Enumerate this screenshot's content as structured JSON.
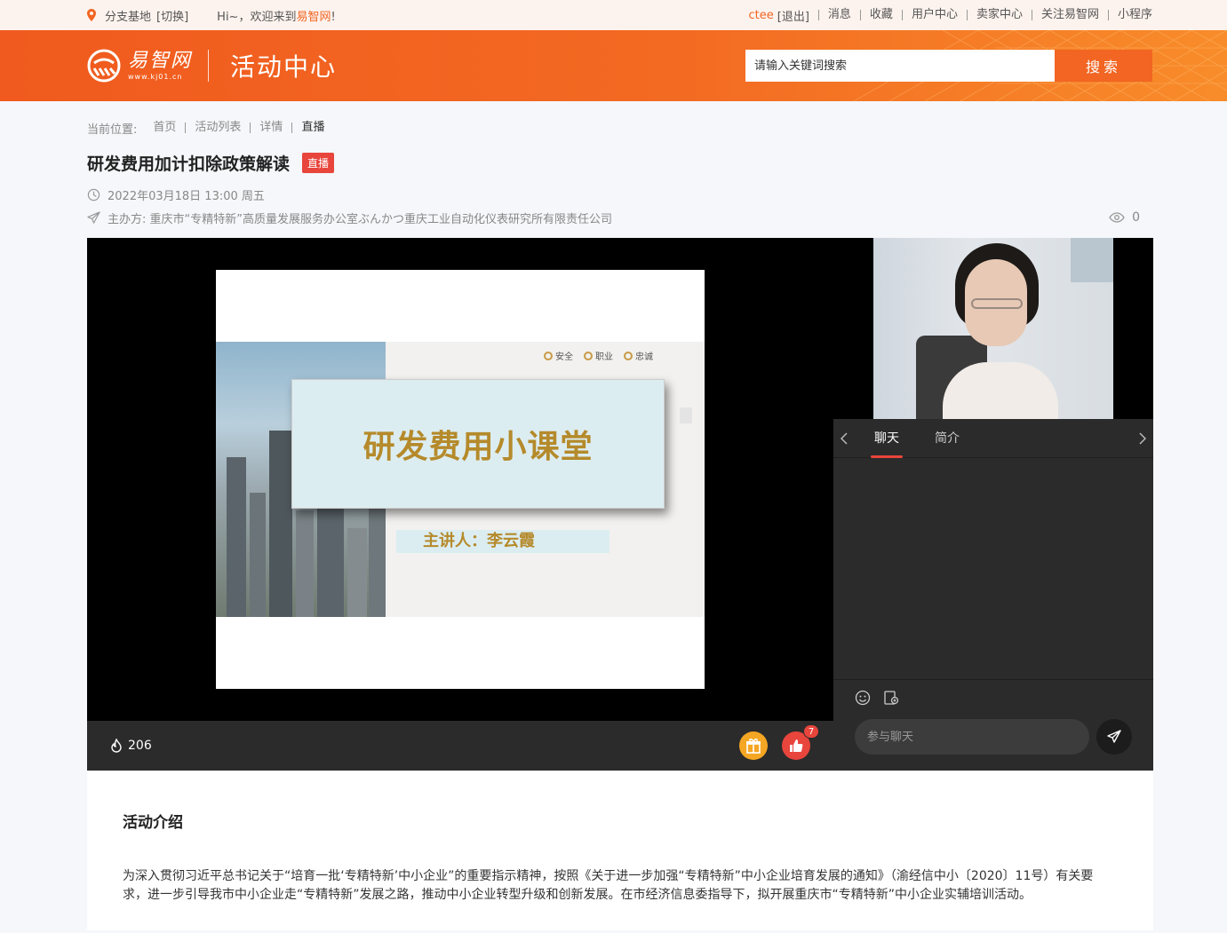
{
  "topbar": {
    "location": "分支基地",
    "switch": "[切换]",
    "greeting": "Hi~，欢迎来到",
    "brand": "易智网",
    "greeting_end": "!",
    "user": "ctee",
    "logout": "[退出]",
    "links": [
      "消息",
      "收藏",
      "用户中心",
      "卖家中心",
      "关注易智网",
      "小程序"
    ]
  },
  "header": {
    "logo_cn": "易智网",
    "logo_en": "www.kj01.cn",
    "section_title": "活动中心",
    "search_placeholder": "请输入关键词搜索",
    "search_button": "搜索"
  },
  "breadcrumb": {
    "label": "当前位置:",
    "items": [
      "首页",
      "活动列表",
      "详情",
      "直播"
    ]
  },
  "event": {
    "title": "研发费用加计扣除政策解读",
    "badge": "直播",
    "datetime": "2022年03月18日 13:00 周五",
    "organizer": "主办方: 重庆市“专精特新”高质量发展服务办公室ぶんかつ重庆工业自动化仪表研究所有限责任公司",
    "views": "0"
  },
  "slide": {
    "tags": [
      "安全",
      "职业",
      "忠诚"
    ],
    "heading": "研发费用小课堂",
    "speaker": "主讲人：李云霞"
  },
  "player": {
    "heat": "206",
    "like_count": "7"
  },
  "sidebar": {
    "tabs": [
      "聊天",
      "简介"
    ],
    "chat_placeholder": "参与聊天"
  },
  "intro": {
    "heading": "活动介绍",
    "body": "为深入贯彻习近平总书记关于“培育一批‘专精特新’中小企业”的重要指示精神，按照《关于进一步加强“专精特新”中小企业培育发展的通知》（渝经信中小〔2020〕11号）有关要求，进一步引导我市中小企业走“专精特新”发展之路，推动中小企业转型升级和创新发展。在市经济信息委指导下，拟开展重庆市“专精特新”中小企业实辅培训活动。"
  },
  "colors": {
    "accent": "#f26522",
    "live_red": "#e8453c",
    "slide_gold": "#b58a2b"
  }
}
